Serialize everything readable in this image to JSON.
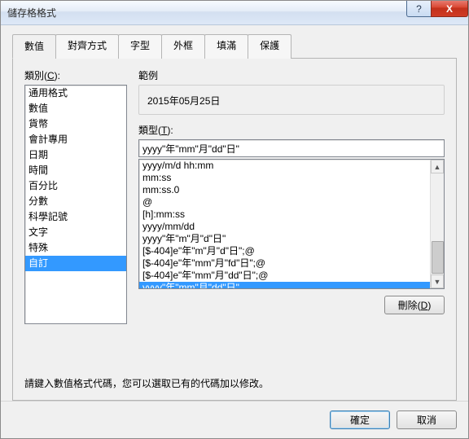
{
  "window": {
    "title": "儲存格格式"
  },
  "titlebar_buttons": {
    "help": "?",
    "close": "X"
  },
  "tabs": [
    {
      "label": "數值",
      "active": true
    },
    {
      "label": "對齊方式"
    },
    {
      "label": "字型"
    },
    {
      "label": "外框"
    },
    {
      "label": "填滿"
    },
    {
      "label": "保護"
    }
  ],
  "left": {
    "label_prefix": "類別(",
    "label_key": "C",
    "label_suffix": "):",
    "items": [
      "通用格式",
      "數值",
      "貨幣",
      "會計專用",
      "日期",
      "時間",
      "百分比",
      "分數",
      "科學記號",
      "文字",
      "特殊",
      "自訂"
    ],
    "selected_index": 11
  },
  "sample": {
    "group_label": "範例",
    "value": "2015年05月25日"
  },
  "type": {
    "label_prefix": "類型(",
    "label_key": "T",
    "label_suffix": "):",
    "input_value": "yyyy\"年\"mm\"月\"dd\"日\""
  },
  "formats": {
    "items": [
      "yyyy/m/d hh:mm",
      "mm:ss",
      "mm:ss.0",
      "@",
      "[h]:mm:ss",
      "yyyy/mm/dd",
      "yyyy\"年\"m\"月\"d\"日\"",
      "[$-404]e\"年\"m\"月\"d\"日\";@",
      "[$-404]e\"年\"mm\"月\"fd\"日\";@",
      "[$-404]e\"年\"mm\"月\"dd\"日\";@",
      "yyyy\"年\"mm\"月\"dd\"日\""
    ],
    "selected_index": 10
  },
  "delete_button": {
    "prefix": "刪除(",
    "key": "D",
    "suffix": ")"
  },
  "hint": "請鍵入數值格式代碼，您可以選取已有的代碼加以修改。",
  "footer": {
    "ok": "確定",
    "cancel": "取消"
  }
}
